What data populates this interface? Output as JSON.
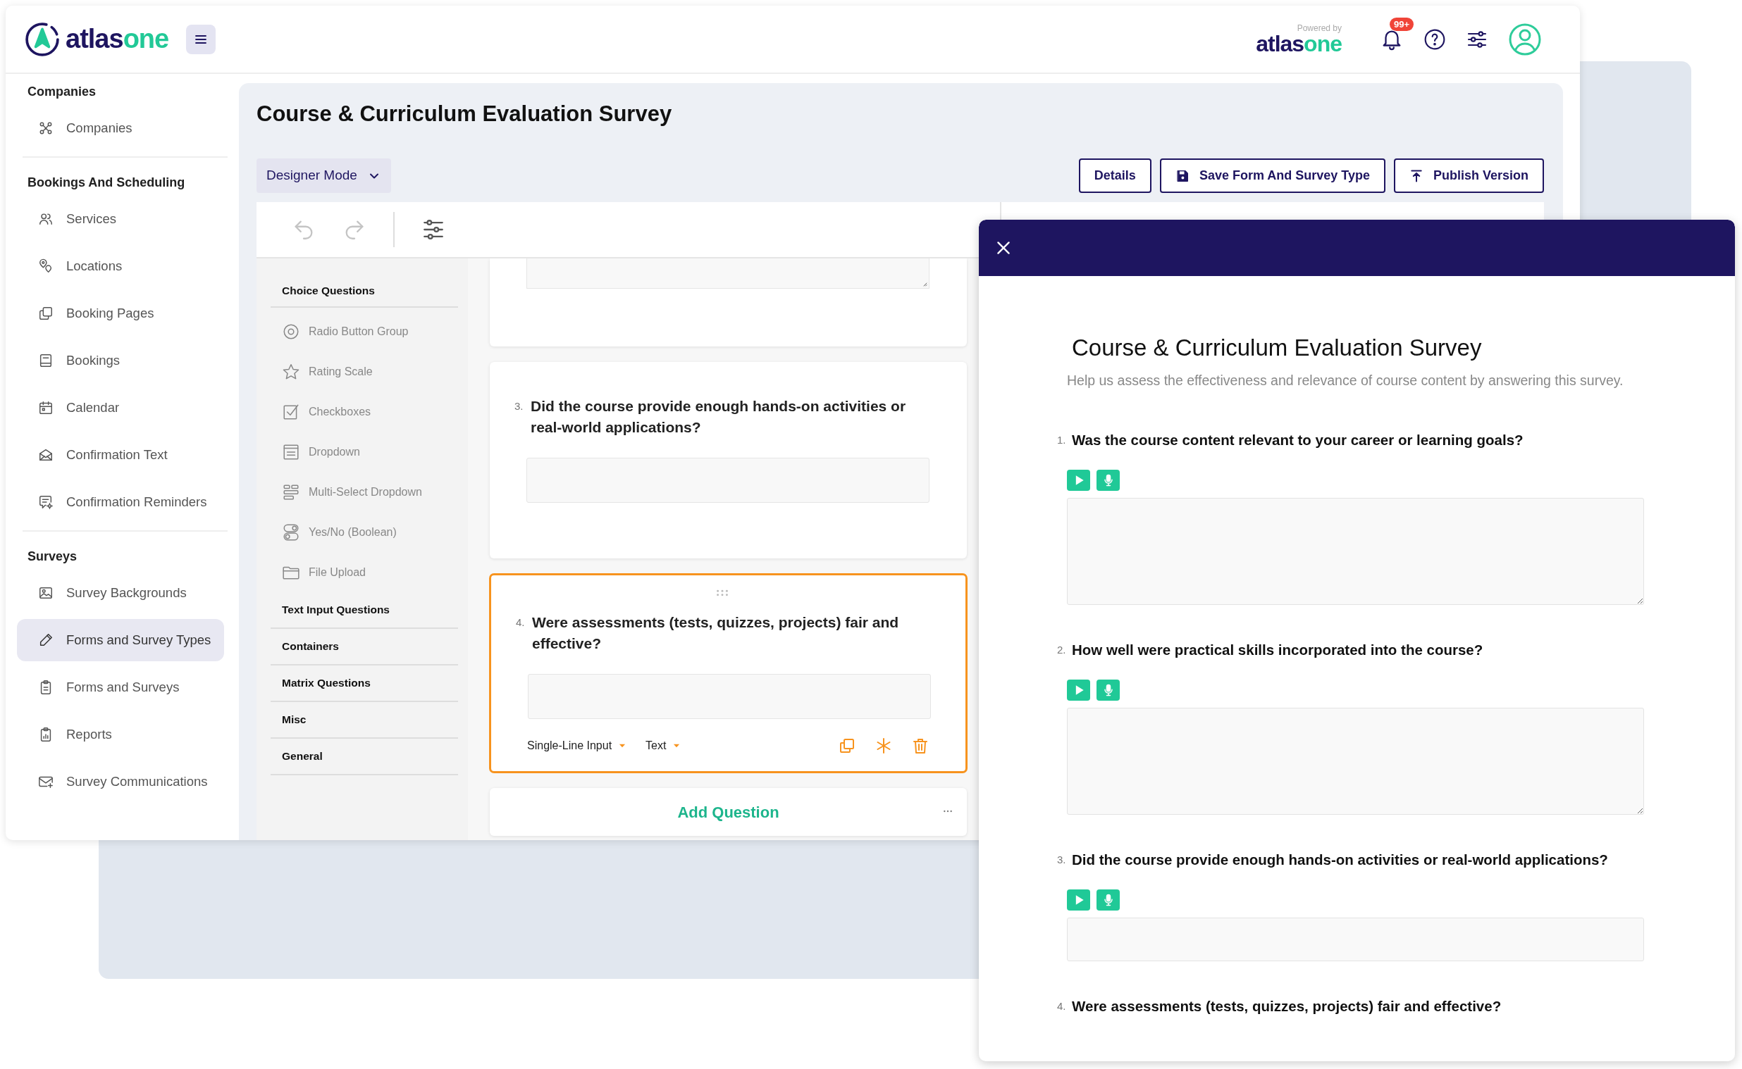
{
  "header": {
    "logo": {
      "main": "atlas",
      "accent": "one"
    },
    "powered_by": {
      "caption": "Powered by",
      "main": "atlas",
      "accent": "one"
    },
    "notification_badge": "99+"
  },
  "sidebar": {
    "sections": [
      {
        "title": "Companies",
        "items": [
          {
            "label": "Companies",
            "selected": false
          }
        ]
      },
      {
        "title": "Bookings And Scheduling",
        "items": [
          {
            "label": "Services",
            "selected": false
          },
          {
            "label": "Locations",
            "selected": false
          },
          {
            "label": "Booking Pages",
            "selected": false
          },
          {
            "label": "Bookings",
            "selected": false
          },
          {
            "label": "Calendar",
            "selected": false
          },
          {
            "label": "Confirmation Text",
            "selected": false
          },
          {
            "label": "Confirmation Reminders",
            "selected": false
          }
        ]
      },
      {
        "title": "Surveys",
        "items": [
          {
            "label": "Survey Backgrounds",
            "selected": false
          },
          {
            "label": "Forms and Survey Types",
            "selected": true
          },
          {
            "label": "Forms and Surveys",
            "selected": false
          },
          {
            "label": "Reports",
            "selected": false
          },
          {
            "label": "Survey Communications",
            "selected": false
          }
        ]
      }
    ]
  },
  "page": {
    "title": "Course & Curriculum Evaluation Survey",
    "mode": "Designer Mode",
    "buttons": [
      {
        "label": "Details",
        "kind": "plain"
      },
      {
        "label": "Save Form And Survey Type",
        "kind": "save"
      },
      {
        "label": "Publish Version",
        "kind": "publish"
      }
    ]
  },
  "toolbar": {
    "undo": {
      "disabled": true
    },
    "redo": {
      "disabled": true
    }
  },
  "toolbox": {
    "categories": [
      {
        "label": "Choice Questions",
        "expanded": true,
        "items": [
          {
            "label": "Radio Button Group",
            "kind": "radio"
          },
          {
            "label": "Rating Scale",
            "kind": "star"
          },
          {
            "label": "Checkboxes",
            "kind": "checkbox"
          },
          {
            "label": "Dropdown",
            "kind": "dropdown"
          },
          {
            "label": "Multi-Select Dropdown",
            "kind": "multiselect"
          },
          {
            "label": "Yes/No (Boolean)",
            "kind": "toggle"
          },
          {
            "label": "File Upload",
            "kind": "folder"
          }
        ]
      },
      {
        "label": "Text Input Questions",
        "expanded": false
      },
      {
        "label": "Containers",
        "expanded": false
      },
      {
        "label": "Matrix Questions",
        "expanded": false
      },
      {
        "label": "Misc",
        "expanded": false
      },
      {
        "label": "General",
        "expanded": false
      }
    ]
  },
  "designer_cards": [
    {
      "kind": "answer-tail"
    },
    {
      "kind": "question",
      "number": "3.",
      "text": "Did the course provide enough hands-on activities or real-world applications?",
      "selected": false
    },
    {
      "kind": "question",
      "number": "4.",
      "text": "Were assessments (tests, quizzes, projects) fair and effective?",
      "selected": true,
      "input_type": "Single-Line Input",
      "data_type": "Text"
    }
  ],
  "add_question": "Add Question",
  "preview": {
    "title": "Course & Curriculum Evaluation Survey",
    "description": "Help us assess the effectiveness and relevance of course content by answering this survey.",
    "questions": [
      {
        "number": "1.",
        "text": "Was the course content relevant to your career or learning goals?",
        "kind": "multiline"
      },
      {
        "number": "2.",
        "text": "How well were practical skills incorporated into the course?",
        "kind": "multiline"
      },
      {
        "number": "3.",
        "text": "Did the course provide enough hands-on activities or real-world applications?",
        "kind": "single"
      },
      {
        "number": "4.",
        "text": "Were assessments (tests, quizzes, projects) fair and effective?",
        "kind": "cut"
      }
    ]
  }
}
